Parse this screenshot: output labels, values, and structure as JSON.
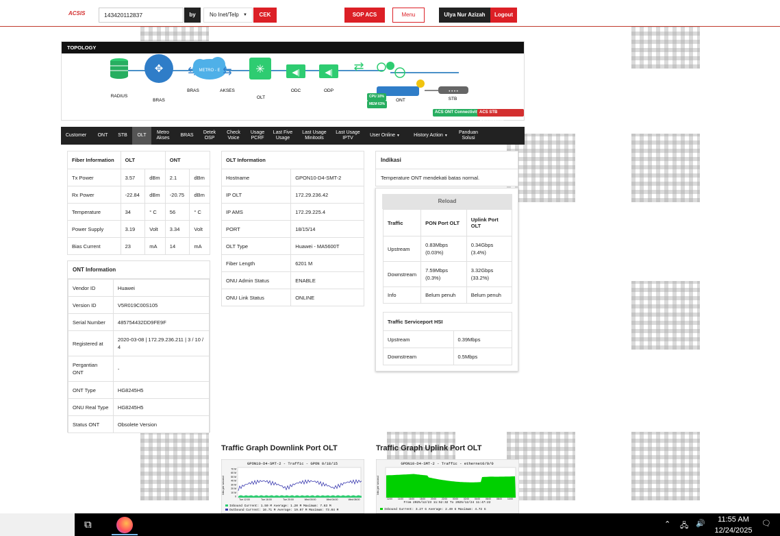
{
  "header": {
    "logo": "ACSIS",
    "search_value": "143420112837",
    "by_label": "by",
    "select_value": "No Inet/Telp",
    "cek_label": "CEK",
    "sop_label": "SOP ACS",
    "menu_label": "Menu",
    "user_name": "Ulya Nur Azizah",
    "logout_label": "Logout"
  },
  "topology": {
    "title": "TOPOLOGY",
    "nodes": [
      "RADIUS",
      "BRAS",
      "BRAS",
      "METRO - E",
      "AKSES",
      "OLT",
      "ODC",
      "ODP",
      "ONT",
      "STB"
    ],
    "badge_count": "5",
    "cpu": "CPU 10%",
    "mem": "MEM 63%",
    "ont_tag": "ACS ONT Connectivity",
    "stb_tag": "ACS STB Connectivity"
  },
  "nav": [
    "Customer",
    "ONT",
    "STB",
    "OLT",
    "Metro Akses",
    "BRAS",
    "Detek OSP",
    "Check Voice",
    "Usage PCRF",
    "Last Five Usage",
    "Last Usage Minitools",
    "Last Usage IPTV",
    "User Online",
    "History Action",
    "Panduan Solusi"
  ],
  "fiber": {
    "headers": [
      "Fiber Information",
      "OLT",
      "ONT"
    ],
    "rows": [
      [
        "Tx Power",
        "3.57",
        "dBm",
        "2.1",
        "dBm"
      ],
      [
        "Rx Power",
        "-22.84",
        "dBm",
        "-20.75",
        "dBm"
      ],
      [
        "Temperature",
        "34",
        "° C",
        "56",
        "° C"
      ],
      [
        "Power Supply",
        "3.19",
        "Volt",
        "3.34",
        "Volt"
      ],
      [
        "Bias Current",
        "23",
        "mA",
        "14",
        "mA"
      ]
    ]
  },
  "ont_info": {
    "title": "ONT Information",
    "rows": [
      [
        "Vendor ID",
        "Huawei"
      ],
      [
        "Version ID",
        "V5R019C00S105"
      ],
      [
        "Serial Number",
        "485754432DD9FE9F"
      ],
      [
        "Registered at",
        "2020-03-08 | 172.29.236.211 | 3 / 10 / 4"
      ],
      [
        "Pergantian ONT",
        "-"
      ],
      [
        "ONT Type",
        "HG8245H5"
      ],
      [
        "ONU Real Type",
        "HG8245H5"
      ],
      [
        "Status ONT",
        "Obsolete Version"
      ]
    ]
  },
  "olt_info": {
    "title": "OLT Information",
    "rows": [
      [
        "Hostname",
        "GPON10-D4-SMT-2"
      ],
      [
        "IP OLT",
        "172.29.236.42"
      ],
      [
        "IP AMS",
        "172.29.225.4"
      ],
      [
        "PORT",
        "18/15/14"
      ],
      [
        "OLT Type",
        "Huawei - MA5600T"
      ],
      [
        "Fiber Length",
        "6201 M"
      ],
      [
        "ONU Admin Status",
        "ENABLE"
      ],
      [
        "ONU Link Status",
        "ONLINE"
      ]
    ]
  },
  "indikasi": {
    "title": "Indikasi",
    "text": "Temperature ONT mendekati batas normal."
  },
  "traffic": {
    "reload_label": "Reload",
    "headers": [
      "Traffic",
      "PON Port OLT",
      "Uplink Port OLT"
    ],
    "rows": [
      [
        "Upstream",
        "0.83Mbps (0.03%)",
        "0.34Gbps (3.4%)"
      ],
      [
        "Downstream",
        "7.59Mbps (0.3%)",
        "3.32Gbps (33.2%)"
      ],
      [
        "Info",
        "Belum penuh",
        "Belum penuh"
      ]
    ]
  },
  "serviceport": {
    "title": "Traffic Serviceport HSI",
    "rows": [
      [
        "Upstream",
        "0.39Mbps"
      ],
      [
        "Downstream",
        "0.5Mbps"
      ]
    ]
  },
  "graphs": {
    "downlink_title": "Traffic Graph Downlink Port OLT",
    "uplink_title": "Traffic Graph Uplink Port OLT",
    "downlink_chart_title": "GPON10-D4-SMT-2 - Traffic - GPON 0/18/15",
    "uplink_chart_title": "GPON10-D4-SMT-2 - Traffic - ethernet0/9/0",
    "downlink_in": "Inbound   Current:   1.50 M   Average:   1.20 M   Maximum:   7.63 M",
    "downlink_out": "Outbound  Current:  16.71 M   Average:  19.07 M   Maximum:  73.04 M",
    "uplink_range": "From 2025/12/23 11:52:32 To 2025/12/24 11:47:22",
    "uplink_in": "Inbound   Current:   3.27 G   Average:   2.49 G   Maximum:   4.72 G",
    "downlink_y_label": "bits per second",
    "uplink_y_label": "bits per second",
    "downlink_y_ticks": [
      "70 M",
      "60 M",
      "50 M",
      "40 M",
      "30 M",
      "20 M",
      "10 M",
      "0"
    ],
    "downlink_x_ticks": [
      "Tue 12:00",
      "Tue 16:00",
      "Tue 20:00",
      "Wed 00:00",
      "Wed 04:00",
      "Wed 08:00"
    ],
    "uplink_x_ticks": [
      "12:00",
      "14:00",
      "16:00",
      "18:00",
      "20:00",
      "22:00",
      "00:00",
      "02:00",
      "04:00",
      "06:00",
      "08:00",
      "10:00"
    ]
  },
  "taskbar": {
    "time": "11:55 AM",
    "date": "12/24/2025"
  },
  "colors": {
    "brand_red": "#dc1f26",
    "dark": "#222222",
    "green": "#27ae60"
  }
}
